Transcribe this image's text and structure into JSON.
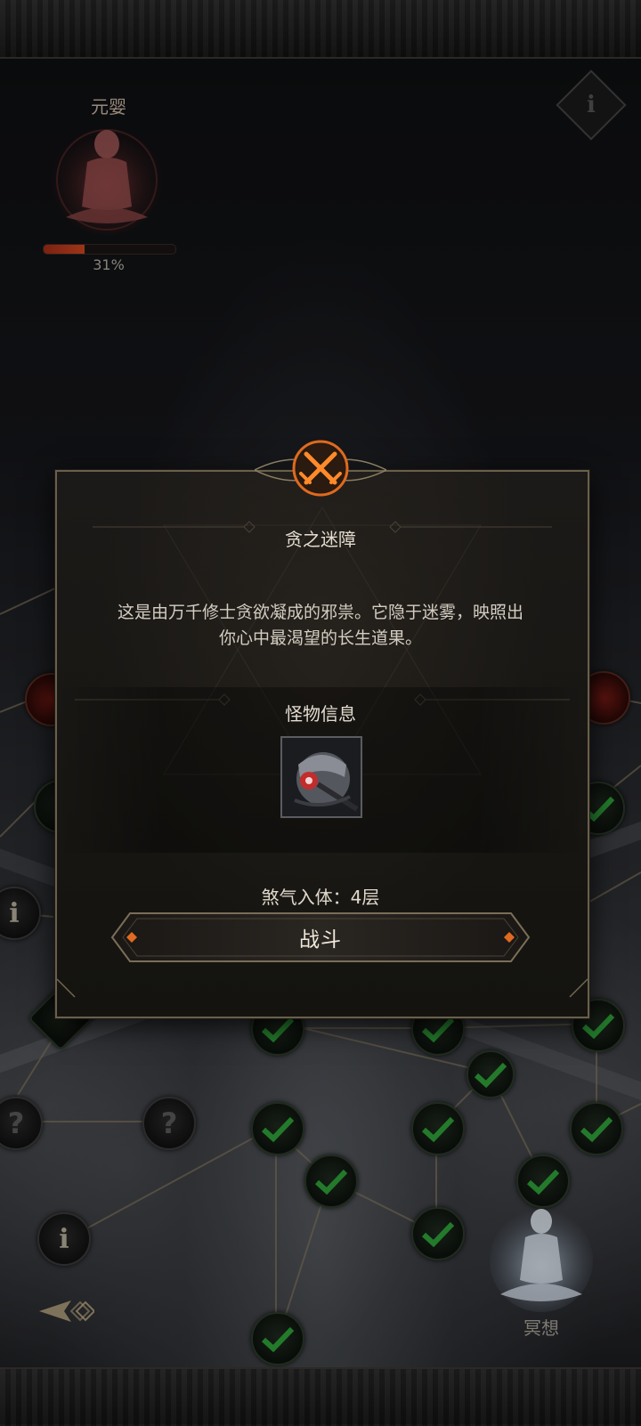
{
  "character": {
    "realm_label": "元婴",
    "progress_text": "31%",
    "progress_fraction": 0.31
  },
  "top_info_icon": "i",
  "map": {
    "info_marker": "i",
    "unknown_marker": "?"
  },
  "meditate_label": "冥想",
  "dialog": {
    "title": "贪之迷障",
    "description": "这是由万千修士贪欲凝成的邪祟。它隐于迷雾，映照出你心中最渴望的长生道果。",
    "section_title": "怪物信息",
    "status_text": "煞气入体：4层",
    "fight_label": "战斗",
    "emblem_icon": "crossed-swords-icon",
    "accent_color": "#e06a1f"
  },
  "colors": {
    "background": "#0c0d0f",
    "frame": "#6a5f4c",
    "progress_fill": "#c63e1c",
    "check": "#2fa33a"
  }
}
